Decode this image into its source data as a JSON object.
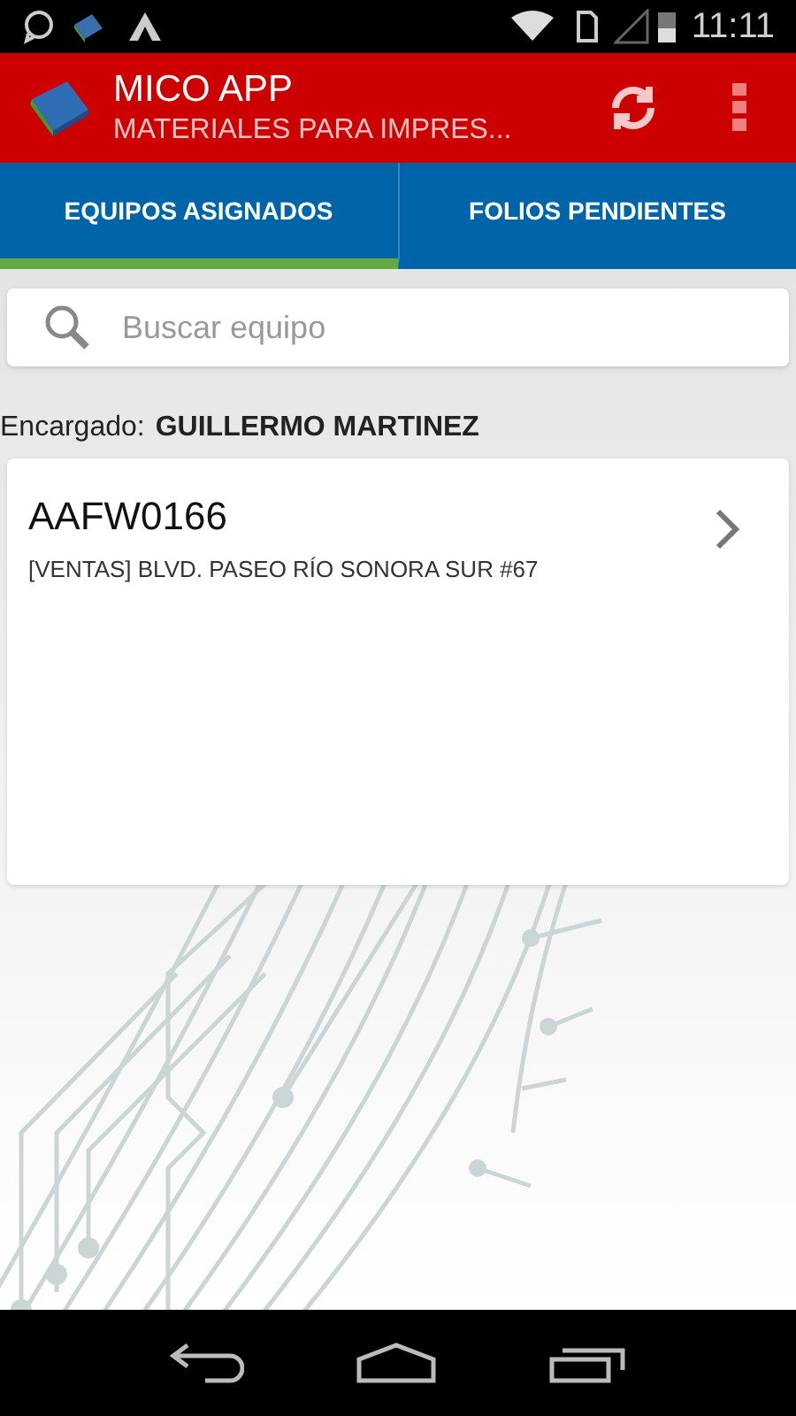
{
  "status_bar": {
    "time": "11:11"
  },
  "app_bar": {
    "title": "MICO APP",
    "subtitle": "MATERIALES PARA IMPRES..."
  },
  "tabs": [
    {
      "label": "EQUIPOS ASIGNADOS",
      "selected": true
    },
    {
      "label": "FOLIOS PENDIENTES",
      "selected": false
    }
  ],
  "search": {
    "placeholder": "Buscar equipo"
  },
  "manager": {
    "label": "Encargado:",
    "name": "GUILLERMO MARTINEZ"
  },
  "equipment": [
    {
      "code": "AAFW0166",
      "location": "[VENTAS] BLVD. PASEO RÍO SONORA SUR #67"
    }
  ]
}
